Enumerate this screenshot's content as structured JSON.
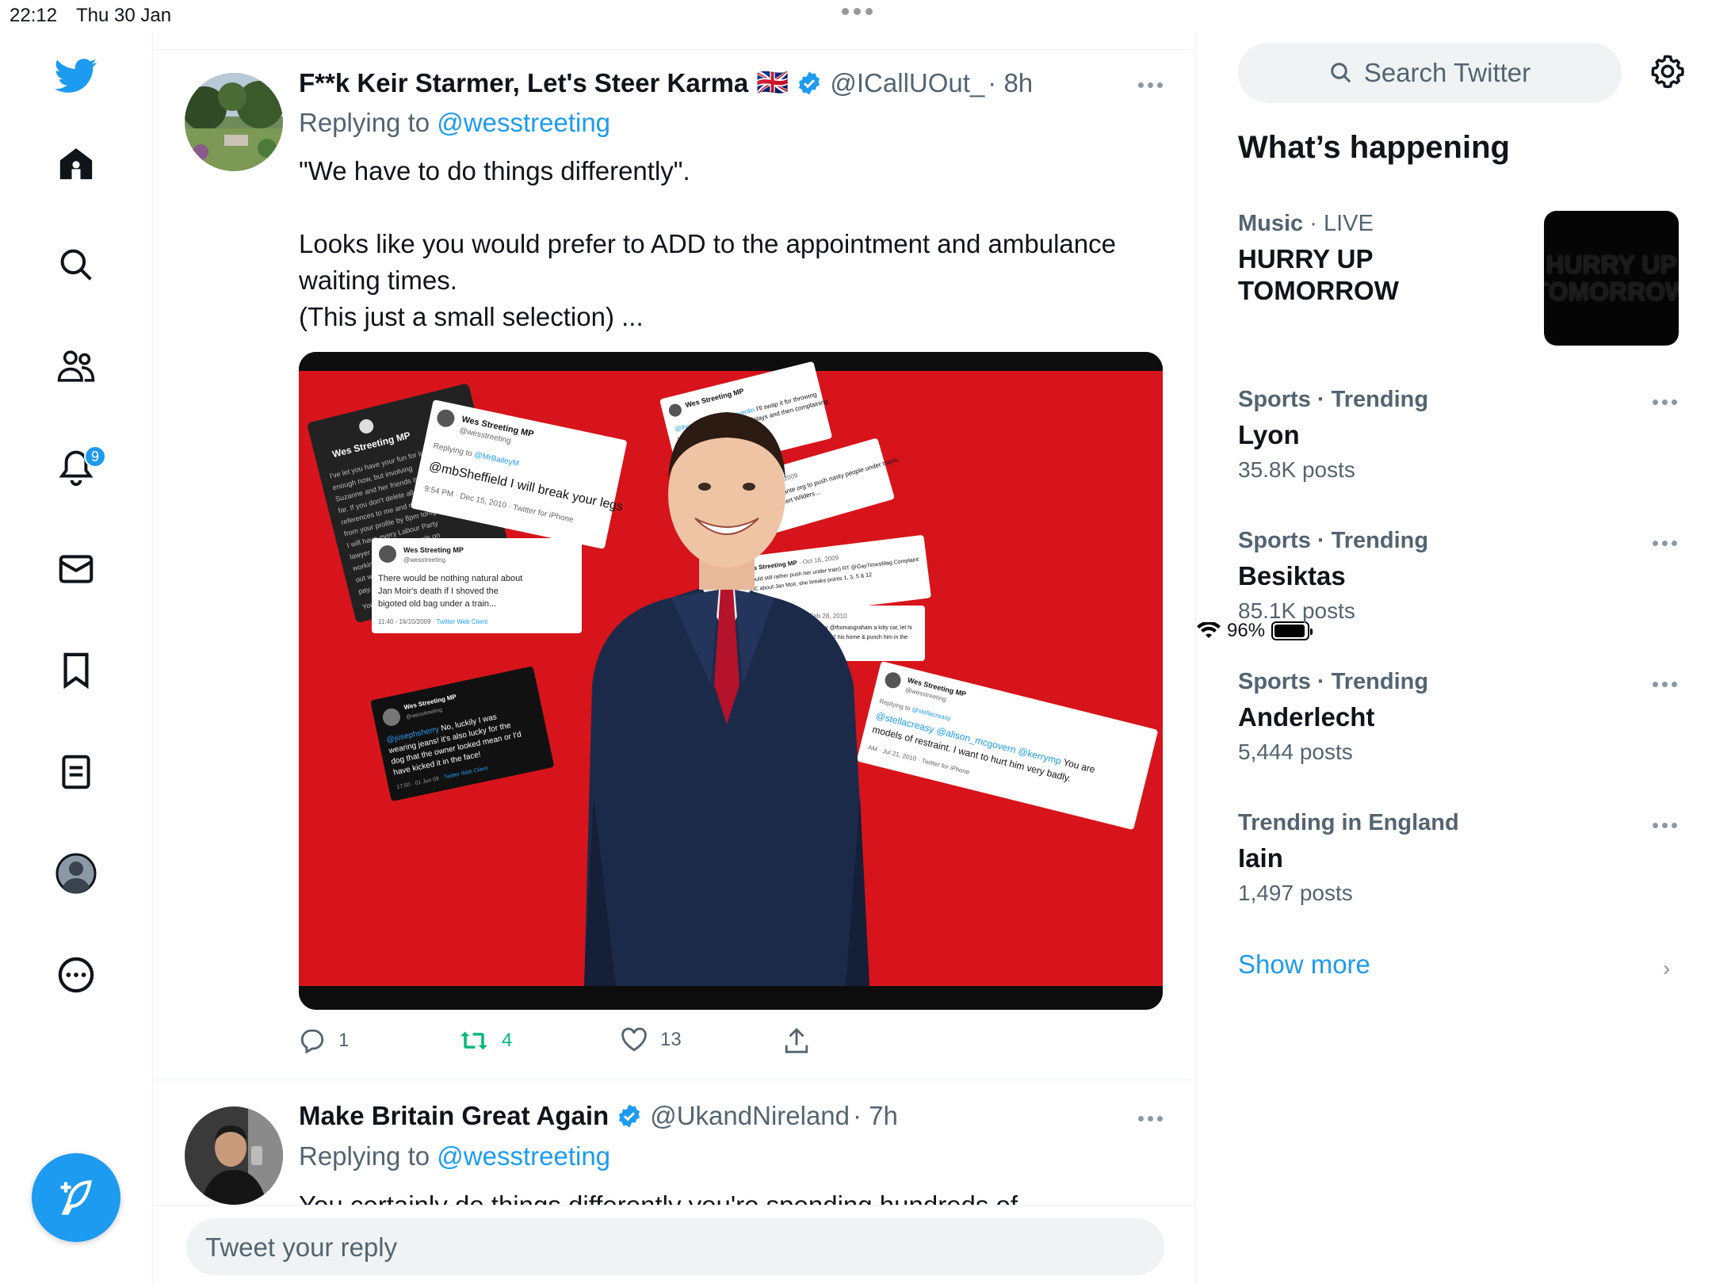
{
  "status_bar": {
    "time": "22:12",
    "date": "Thu 30 Jan",
    "battery": "96%"
  },
  "nav": {
    "notifications_badge": "9"
  },
  "tweets": [
    {
      "name": "F**k Keir Starmer, Let's Steer Karma",
      "flag": "🇬🇧",
      "handle": "@ICallUOut_",
      "time": "· 8h",
      "replying_prefix": "Replying to",
      "replying_to": "@wesstreeting",
      "text_lines": [
        "\"We have to do things differently\".",
        "",
        "Looks like you would prefer to ADD to the appointment and ambulance",
        "waiting times.",
        "(This just a small selection) ..."
      ],
      "replies": "1",
      "retweets": "4",
      "likes": "13"
    },
    {
      "name": "Make Britain Great Again",
      "handle": "@UkandNireland",
      "time": "· 7h",
      "replying_prefix": "Replying to",
      "replying_to": "@wesstreeting",
      "text_partial": "You certainly do things differently you're spending hundreds of"
    }
  ],
  "reply_placeholder": "Tweet your reply",
  "sidebar": {
    "search_placeholder": "Search Twitter",
    "heading": "What’s happening",
    "trends": [
      {
        "category": "Music",
        "qualifier": " · LIVE",
        "title": "HURRY UP TOMORROW",
        "count": "",
        "thumb_text": "HURRY UP TOMORROW"
      },
      {
        "category": "Sports",
        "qualifier": " · Trending",
        "title": "Lyon",
        "count": "35.8K posts"
      },
      {
        "category": "Sports",
        "qualifier": " · Trending",
        "title": "Besiktas",
        "count": "85.1K posts"
      },
      {
        "category": "Sports",
        "qualifier": " · Trending",
        "title": "Anderlecht",
        "count": "5,444 posts"
      },
      {
        "category": "Trending in England",
        "qualifier": "",
        "title": "Iain",
        "count": "1,497 posts"
      }
    ],
    "show_more": "Show more"
  },
  "media_image": {
    "person": "smiling man in navy suit and red tie on red background",
    "tweet_cards": [
      {
        "name": "Wes Streeting MP",
        "handle": "@wesstreeting",
        "text": "I've let you have your fun for long enough now, but involving Suzanne and her friends is too far. If you don't delete all references to me and my work from your profile by 8pm tonight, I will have every Labour Party lawyer I can get my hands on working around the clock to find out who you are and make you pay. Your choice. I wouldn't risk it."
      },
      {
        "name": "Wes Streeting MP",
        "handle": "@wesstreeting",
        "reply": "Replying to @MrBaileyM",
        "text": "@mbSheffield I will break your legs",
        "meta": "9:54 PM · Dec 15, 2010 · Twitter for iPhone"
      },
      {
        "name": "Wes Streeting MP",
        "handle": "@wesstreeting",
        "text": "There would be nothing natural about Jan Moir's death if I shoved the bigoted old bag under a train...",
        "meta": "11:40 - 16/10/2009 · Twitter Web Client"
      },
      {
        "name": "Wes Streeting MP",
        "handle": "@wesstreeting",
        "text": "@josephsherry No, luckily I was wearing jeans! it's also lucky for the dog that the owner looked mean or I'd have kicked it in the face!",
        "meta": "17:50 · 01 Jun 09 · Twitter Web Client"
      },
      {
        "name": "Wes Streeting MP",
        "handle": "@wesstreeting",
        "text": "@stellacreasy @alison_mcgovern @kerrymp You are models of restraint. I want to hurt him very badly.",
        "meta": "AM · Jul 21, 2010 · Twitter for iPhone"
      },
      {
        "name": "Wes Streeting MP",
        "text": "I'll swap it for throwing you under a train, causing delays and then complaining about the delays."
      },
      {
        "name": "Wes Streeting MP",
        "text": "Considering starting my own vigilante org to push nasty people under trains. First up Jan Moir, followed by Geert Wilders...",
        "meta": "Oct 16, 2009"
      },
      {
        "name": "Wes Streeting MP",
        "text": "Would still rather push her under train) RT @GayTimesMag Complaint PCC about Jan Moir, she breaks points 1, 3, 5 & 12",
        "meta": "Oct 16, 2009"
      },
      {
        "name": "Wes Streeting MP",
        "text": "@HughMurdoch Am gonna buy @thomasgraham a kitty cat, let hi love wiv the kitty cat, then steal in2 his home & punch him in the",
        "meta": "Feb 28, 2010"
      }
    ]
  },
  "colors": {
    "accent": "#1d9bf0",
    "retweet_green": "#00ba7c",
    "muted": "#536471",
    "border": "#eff3f4",
    "media_red": "#d7141b"
  },
  "icons": [
    "twitter-logo-icon",
    "home-icon",
    "search-icon",
    "communities-icon",
    "bell-icon",
    "mail-icon",
    "bookmark-icon",
    "list-icon",
    "profile-icon",
    "more-circle-icon",
    "compose-icon",
    "verified-icon",
    "reply-icon",
    "retweet-icon",
    "like-icon",
    "share-icon",
    "gear-icon",
    "chevron-right-icon",
    "more-dots-icon"
  ]
}
